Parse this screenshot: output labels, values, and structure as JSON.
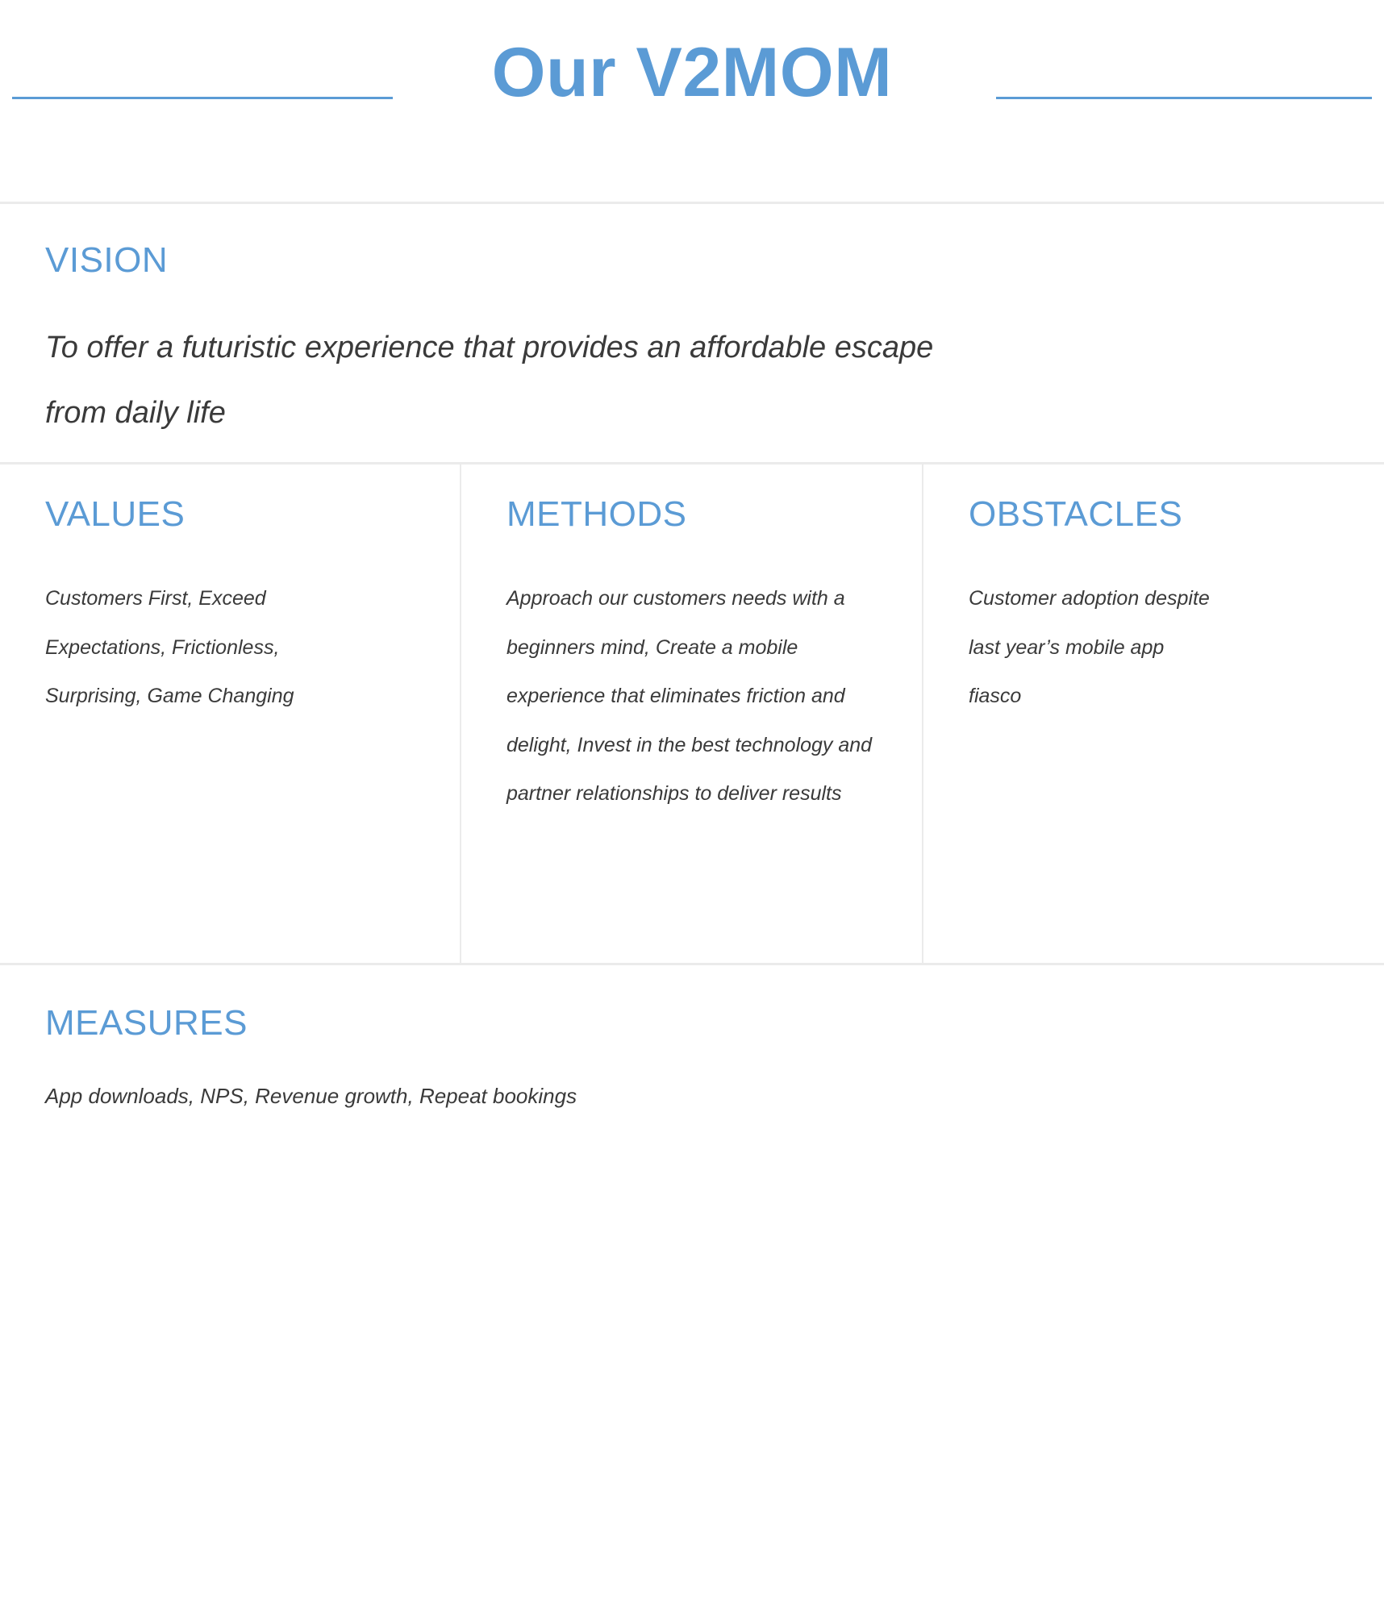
{
  "header": {
    "title": "Our V2MOM",
    "accent_color": "#5B9BD5",
    "rule_color": "#5B9BD5"
  },
  "colors": {
    "accent_blue": "#5B9BD5",
    "body_text": "#3a3a3a",
    "divider": "#ebebeb",
    "background": "#ffffff"
  },
  "vision": {
    "heading": "VISION",
    "body": "To offer a futuristic experience that provides an affordable escape from daily life"
  },
  "columns": [
    {
      "heading": "VALUES",
      "body": "Customers First, Exceed Expectations, Frictionless, Surprising, Game Changing"
    },
    {
      "heading": "METHODS",
      "body": "Approach our customers needs with a beginners mind, Create a mobile experience that eliminates friction and delight, Invest in the best technology and partner relationships to deliver results"
    },
    {
      "heading": "OBSTACLES",
      "body": "Customer adoption despite last year’s mobile app fiasco"
    }
  ],
  "measures": {
    "heading": "MEASURES",
    "body": "App downloads, NPS, Revenue growth, Repeat bookings"
  }
}
